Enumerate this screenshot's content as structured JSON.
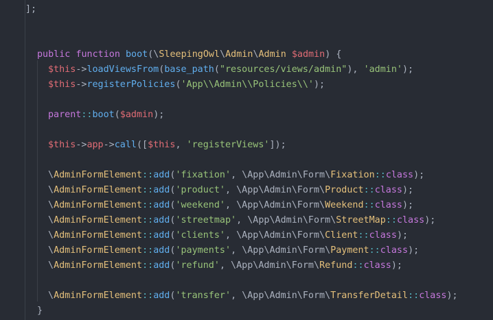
{
  "lines": [
    {
      "tokens": [
        {
          "t": "];",
          "c": "pl"
        }
      ]
    },
    {
      "tokens": []
    },
    {
      "tokens": []
    },
    {
      "tokens": [
        {
          "t": "public",
          "c": "kw"
        },
        {
          "t": " ",
          "c": "pl"
        },
        {
          "t": "function",
          "c": "kw"
        },
        {
          "t": " ",
          "c": "pl"
        },
        {
          "t": "boot",
          "c": "fn"
        },
        {
          "t": "(\\",
          "c": "pl"
        },
        {
          "t": "SleepingOwl",
          "c": "cls"
        },
        {
          "t": "\\",
          "c": "pl"
        },
        {
          "t": "Admin",
          "c": "cls"
        },
        {
          "t": "\\",
          "c": "pl"
        },
        {
          "t": "Admin",
          "c": "cls"
        },
        {
          "t": " ",
          "c": "pl"
        },
        {
          "t": "$admin",
          "c": "var"
        },
        {
          "t": ") {",
          "c": "pl"
        }
      ]
    },
    {
      "tokens": [
        {
          "t": "$this",
          "c": "var"
        },
        {
          "t": "->",
          "c": "pl"
        },
        {
          "t": "loadViewsFrom",
          "c": "fn"
        },
        {
          "t": "(",
          "c": "pl"
        },
        {
          "t": "base_path",
          "c": "fn"
        },
        {
          "t": "(",
          "c": "pl"
        },
        {
          "t": "\"resources/views/admin\"",
          "c": "str"
        },
        {
          "t": "), ",
          "c": "pl"
        },
        {
          "t": "'admin'",
          "c": "str"
        },
        {
          "t": ");",
          "c": "pl"
        }
      ]
    },
    {
      "tokens": [
        {
          "t": "$this",
          "c": "var"
        },
        {
          "t": "->",
          "c": "pl"
        },
        {
          "t": "registerPolicies",
          "c": "fn"
        },
        {
          "t": "(",
          "c": "pl"
        },
        {
          "t": "'App\\\\Admin\\\\Policies\\\\'",
          "c": "str"
        },
        {
          "t": ");",
          "c": "pl"
        }
      ]
    },
    {
      "tokens": []
    },
    {
      "tokens": [
        {
          "t": "parent",
          "c": "kw"
        },
        {
          "t": "::",
          "c": "op"
        },
        {
          "t": "boot",
          "c": "fn"
        },
        {
          "t": "(",
          "c": "pl"
        },
        {
          "t": "$admin",
          "c": "var"
        },
        {
          "t": ");",
          "c": "pl"
        }
      ]
    },
    {
      "tokens": []
    },
    {
      "tokens": [
        {
          "t": "$this",
          "c": "var"
        },
        {
          "t": "->",
          "c": "pl"
        },
        {
          "t": "app",
          "c": "var"
        },
        {
          "t": "->",
          "c": "pl"
        },
        {
          "t": "call",
          "c": "fn"
        },
        {
          "t": "([",
          "c": "pl"
        },
        {
          "t": "$this",
          "c": "var"
        },
        {
          "t": ", ",
          "c": "pl"
        },
        {
          "t": "'registerViews'",
          "c": "str"
        },
        {
          "t": "]);",
          "c": "pl"
        }
      ]
    },
    {
      "tokens": []
    },
    {
      "tokens": [
        {
          "t": "\\",
          "c": "pl"
        },
        {
          "t": "AdminFormElement",
          "c": "cls"
        },
        {
          "t": "::",
          "c": "op"
        },
        {
          "t": "add",
          "c": "fn"
        },
        {
          "t": "(",
          "c": "pl"
        },
        {
          "t": "'fixation'",
          "c": "str"
        },
        {
          "t": ", \\App\\Admin\\Form\\",
          "c": "pl"
        },
        {
          "t": "Fixation",
          "c": "cls"
        },
        {
          "t": "::",
          "c": "op"
        },
        {
          "t": "class",
          "c": "kw"
        },
        {
          "t": ");",
          "c": "pl"
        }
      ]
    },
    {
      "tokens": [
        {
          "t": "\\",
          "c": "pl"
        },
        {
          "t": "AdminFormElement",
          "c": "cls"
        },
        {
          "t": "::",
          "c": "op"
        },
        {
          "t": "add",
          "c": "fn"
        },
        {
          "t": "(",
          "c": "pl"
        },
        {
          "t": "'product'",
          "c": "str"
        },
        {
          "t": ", \\App\\Admin\\Form\\",
          "c": "pl"
        },
        {
          "t": "Product",
          "c": "cls"
        },
        {
          "t": "::",
          "c": "op"
        },
        {
          "t": "class",
          "c": "kw"
        },
        {
          "t": ");",
          "c": "pl"
        }
      ]
    },
    {
      "tokens": [
        {
          "t": "\\",
          "c": "pl"
        },
        {
          "t": "AdminFormElement",
          "c": "cls"
        },
        {
          "t": "::",
          "c": "op"
        },
        {
          "t": "add",
          "c": "fn"
        },
        {
          "t": "(",
          "c": "pl"
        },
        {
          "t": "'weekend'",
          "c": "str"
        },
        {
          "t": ", \\App\\Admin\\Form\\",
          "c": "pl"
        },
        {
          "t": "Weekend",
          "c": "cls"
        },
        {
          "t": "::",
          "c": "op"
        },
        {
          "t": "class",
          "c": "kw"
        },
        {
          "t": ");",
          "c": "pl"
        }
      ]
    },
    {
      "tokens": [
        {
          "t": "\\",
          "c": "pl"
        },
        {
          "t": "AdminFormElement",
          "c": "cls"
        },
        {
          "t": "::",
          "c": "op"
        },
        {
          "t": "add",
          "c": "fn"
        },
        {
          "t": "(",
          "c": "pl"
        },
        {
          "t": "'streetmap'",
          "c": "str"
        },
        {
          "t": ", \\App\\Admin\\Form\\",
          "c": "pl"
        },
        {
          "t": "StreetMap",
          "c": "cls"
        },
        {
          "t": "::",
          "c": "op"
        },
        {
          "t": "class",
          "c": "kw"
        },
        {
          "t": ");",
          "c": "pl"
        }
      ]
    },
    {
      "tokens": [
        {
          "t": "\\",
          "c": "pl"
        },
        {
          "t": "AdminFormElement",
          "c": "cls"
        },
        {
          "t": "::",
          "c": "op"
        },
        {
          "t": "add",
          "c": "fn"
        },
        {
          "t": "(",
          "c": "pl"
        },
        {
          "t": "'clients'",
          "c": "str"
        },
        {
          "t": ", \\App\\Admin\\Form\\",
          "c": "pl"
        },
        {
          "t": "Client",
          "c": "cls"
        },
        {
          "t": "::",
          "c": "op"
        },
        {
          "t": "class",
          "c": "kw"
        },
        {
          "t": ");",
          "c": "pl"
        }
      ]
    },
    {
      "tokens": [
        {
          "t": "\\",
          "c": "pl"
        },
        {
          "t": "AdminFormElement",
          "c": "cls"
        },
        {
          "t": "::",
          "c": "op"
        },
        {
          "t": "add",
          "c": "fn"
        },
        {
          "t": "(",
          "c": "pl"
        },
        {
          "t": "'payments'",
          "c": "str"
        },
        {
          "t": ", \\App\\Admin\\Form\\",
          "c": "pl"
        },
        {
          "t": "Payment",
          "c": "cls"
        },
        {
          "t": "::",
          "c": "op"
        },
        {
          "t": "class",
          "c": "kw"
        },
        {
          "t": ");",
          "c": "pl"
        }
      ]
    },
    {
      "tokens": [
        {
          "t": "\\",
          "c": "pl"
        },
        {
          "t": "AdminFormElement",
          "c": "cls"
        },
        {
          "t": "::",
          "c": "op"
        },
        {
          "t": "add",
          "c": "fn"
        },
        {
          "t": "(",
          "c": "pl"
        },
        {
          "t": "'refund'",
          "c": "str"
        },
        {
          "t": ", \\App\\Admin\\Form\\",
          "c": "pl"
        },
        {
          "t": "Refund",
          "c": "cls"
        },
        {
          "t": "::",
          "c": "op"
        },
        {
          "t": "class",
          "c": "kw"
        },
        {
          "t": ");",
          "c": "pl"
        }
      ]
    },
    {
      "tokens": []
    },
    {
      "tokens": [
        {
          "t": "\\",
          "c": "pl"
        },
        {
          "t": "AdminFormElement",
          "c": "cls"
        },
        {
          "t": "::",
          "c": "op"
        },
        {
          "t": "add",
          "c": "fn"
        },
        {
          "t": "(",
          "c": "pl"
        },
        {
          "t": "'transfer'",
          "c": "str"
        },
        {
          "t": ", \\App\\Admin\\Form\\",
          "c": "pl"
        },
        {
          "t": "TransferDetail",
          "c": "cls"
        },
        {
          "t": "::",
          "c": "op"
        },
        {
          "t": "class",
          "c": "kw"
        },
        {
          "t": ");",
          "c": "pl"
        }
      ]
    },
    {
      "tokens": [
        {
          "t": "}",
          "c": "pl"
        }
      ]
    }
  ]
}
